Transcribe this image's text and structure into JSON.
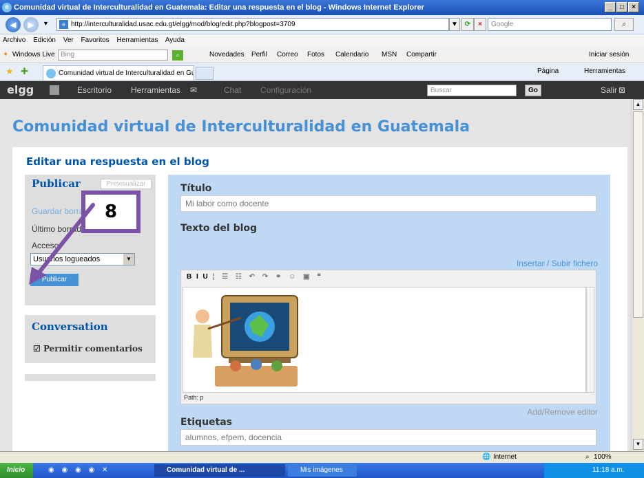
{
  "window": {
    "title": "Comunidad virtual de Interculturalidad en Guatemala: Editar una respuesta en el blog - Windows Internet Explorer",
    "minimize": "_",
    "maximize": "□",
    "close": "×"
  },
  "browser": {
    "address": "http://interculturalidad.usac.edu.gt/elgg/mod/blog/edit.php?blogpost=3709",
    "search_placeholder": "Google",
    "menu": [
      "Archivo",
      "Edición",
      "Ver",
      "Favoritos",
      "Herramientas",
      "Ayuda"
    ],
    "live": {
      "label": "Windows Live",
      "search_value": "Bing",
      "links": [
        "Novedades",
        "Perfil",
        "Correo",
        "Fotos",
        "Calendario",
        "MSN",
        "Compartir"
      ],
      "signin": "Iniciar sesión"
    },
    "tab_title": "Comunidad virtual de Interculturalidad en Guatemala: ...",
    "tools": {
      "page": "Página",
      "tools": "Herramientas"
    }
  },
  "elgg": {
    "logo": "elgg",
    "nav": [
      "Escritorio",
      "Herramientas",
      "Chat",
      "Configuración"
    ],
    "search_placeholder": "Buscar",
    "go": "Go",
    "logout": "Salir"
  },
  "page": {
    "site_title": "Comunidad virtual de Interculturalidad en Guatemala",
    "heading": "Editar una respuesta en el blog"
  },
  "sidebar": {
    "publish_heading": "Publicar",
    "preview": "Previsualizar",
    "save_draft": "Guardar borrador",
    "last_draft": "Último borrador",
    "access_label": "Acceso",
    "access_value": "Usuarios logueados",
    "publish_button": "Publicar",
    "conversation_heading": "Conversation",
    "allow_comments": "Permitir comentarios"
  },
  "form": {
    "title_label": "Título",
    "title_value": "Mi labor como docente",
    "body_label": "Texto del blog",
    "insert_link": "Insertar / Subir fichero",
    "toolbar": "B I U",
    "path": "Path: p",
    "add_remove": "Add/Remove editor",
    "tags_label": "Etiquetas",
    "tags_value": "alumnos, efpem, docencia"
  },
  "annotation": {
    "number": "8",
    "color": "#7a52a6"
  },
  "status": {
    "zone": "Internet",
    "zoom": "100%"
  },
  "taskbar": {
    "start": "Inicio",
    "task1": "Comunidad virtual de ...",
    "task2": "Mis imágenes",
    "clock": "11:18 a.m."
  },
  "colors": {
    "elgg_blue": "#4690d6",
    "panel_blue": "#bfd9f4",
    "heading_blue": "#0054a7"
  }
}
